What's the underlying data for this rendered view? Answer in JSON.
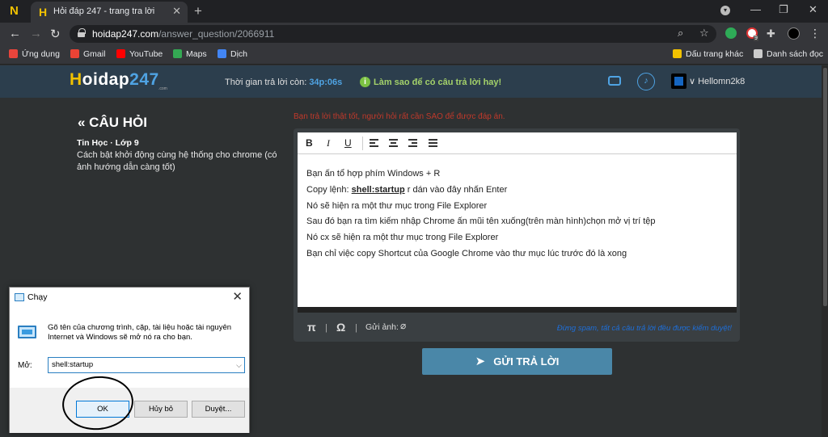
{
  "browser": {
    "tab_title": "Hỏi đáp 247 - trang tra lời",
    "url_host": "hoidap247.com",
    "url_path": "/answer_question/2066911",
    "extension_badge": "9",
    "bookmarks": [
      {
        "label": "Ứng dụng",
        "color": "#e8453c"
      },
      {
        "label": "Gmail",
        "color": "#ea4335"
      },
      {
        "label": "YouTube",
        "color": "#ff0000"
      },
      {
        "label": "Maps",
        "color": "#34a853"
      },
      {
        "label": "Dịch",
        "color": "#4285f4"
      }
    ],
    "bookmarks_right": [
      {
        "label": "Dấu trang khác",
        "color": "#f2c200"
      },
      {
        "label": "Danh sách đọc",
        "color": "#cccccc"
      }
    ]
  },
  "header": {
    "logo_h": "H",
    "logo_oidap": "oidap",
    "logo_num": "247",
    "logo_sub": ".com",
    "timer_label": "Thời gian trả lời còn: ",
    "timer_value": "34p:06s",
    "howto": "Làm sao để có câu trả lời hay!",
    "username": "Hellomn2k8"
  },
  "question": {
    "title": "« CÂU HỎI",
    "subject": "Tin Học · Lớp 9",
    "text": "Cách bật khởi động cùng hệ thống cho chrome (có ảnh hướng dẫn càng tốt)"
  },
  "editor": {
    "notice": "Bạn trả lời thật tốt, người hỏi rất cần SAO để được đáp án.",
    "toolbar": {
      "bold": "B",
      "italic": "I",
      "underline": "U"
    },
    "lines": [
      "Bạn ấn tổ hợp phím Windows + R",
      "Nó sẽ hiện ra một thư mục trong File Explorer",
      "Sau đó bạn ra tìm kiếm nhập Chrome ấn mũi tên xuống(trên màn hình)chọn mở vị trí tệp",
      "Nó cx sẽ hiện ra một thư mục trong File Explorer",
      "Bạn chỉ việc copy Shortcut  của Google Chrome vào thư mục lúc trước đó là xong"
    ],
    "copy_prefix": "Copy lệnh: ",
    "copy_cmd": "shell:startup",
    "copy_suffix": " r dán vào đây nhấn Enter",
    "footer_pi": "π",
    "footer_omega": "Ω",
    "image_label": "Gửi ảnh:",
    "spam_notice": "Đừng spam, tất cả câu trả lời đều được kiểm duyệt!",
    "submit_label": "GỬI TRẢ LỜI"
  },
  "run_dialog": {
    "title": "Chạy",
    "description": "Gõ tên của chương trình, cặp, tài liệu hoặc tài nguyên Internet và Windows sẽ mở nó ra cho bạn.",
    "open_label": "Mở:",
    "input_value": "shell:startup",
    "ok_label": "OK",
    "cancel_label": "Hủy bỏ",
    "browse_label": "Duyệt..."
  }
}
